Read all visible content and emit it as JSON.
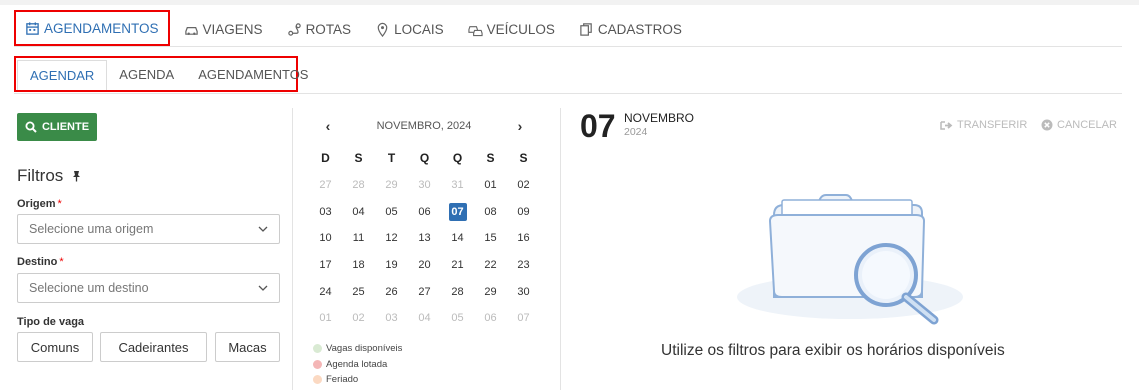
{
  "nav": {
    "items": [
      {
        "label": "AGENDAMENTOS",
        "icon": "calendar-icon"
      },
      {
        "label": "VIAGENS",
        "icon": "car-icon"
      },
      {
        "label": "ROTAS",
        "icon": "route-icon"
      },
      {
        "label": "LOCAIS",
        "icon": "map-pin-icon"
      },
      {
        "label": "VEÍCULOS",
        "icon": "vehicles-icon"
      },
      {
        "label": "CADASTROS",
        "icon": "copy-icon"
      }
    ]
  },
  "subnav": {
    "tabs": [
      "AGENDAR",
      "AGENDA",
      "AGENDAMENTOS"
    ]
  },
  "left": {
    "cliente_button": "CLIENTE",
    "filters_title": "Filtros",
    "origem_label": "Origem",
    "origem_placeholder": "Selecione uma origem",
    "destino_label": "Destino",
    "destino_placeholder": "Selecione um destino",
    "tipo_vaga_label": "Tipo de vaga",
    "tipo_vaga_options": [
      "Comuns",
      "Cadeirantes",
      "Macas"
    ]
  },
  "calendar": {
    "month_label": "NOVEMBRO, 2024",
    "prev": "‹",
    "next": "›",
    "weekdays": [
      "D",
      "S",
      "T",
      "Q",
      "Q",
      "S",
      "S"
    ],
    "weeks": [
      [
        "27",
        "28",
        "29",
        "30",
        "31",
        "01",
        "02"
      ],
      [
        "03",
        "04",
        "05",
        "06",
        "07",
        "08",
        "09"
      ],
      [
        "10",
        "11",
        "12",
        "13",
        "14",
        "15",
        "16"
      ],
      [
        "17",
        "18",
        "19",
        "20",
        "21",
        "22",
        "23"
      ],
      [
        "24",
        "25",
        "26",
        "27",
        "28",
        "29",
        "30"
      ],
      [
        "01",
        "02",
        "03",
        "04",
        "05",
        "06",
        "07"
      ]
    ],
    "selected": "07",
    "legend": [
      {
        "label": "Vagas disponíveis",
        "color": "#d9ead3"
      },
      {
        "label": "Agenda lotada",
        "color": "#f4b6b6"
      },
      {
        "label": "Feriado",
        "color": "#fbd9c2"
      }
    ]
  },
  "detail": {
    "day": "07",
    "month": "NOVEMBRO",
    "year": "2024",
    "transferir": "TRANSFERIR",
    "cancelar": "CANCELAR",
    "empty_message": "Utilize os filtros para exibir os horários disponíveis"
  },
  "colors": {
    "accent": "#2f6fb3",
    "green": "#3a8b48",
    "highlight": "#e00000"
  }
}
